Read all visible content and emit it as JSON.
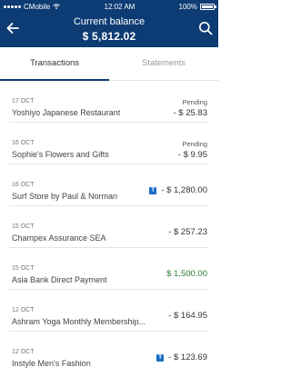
{
  "status_bar": {
    "carrier": "CMobile",
    "time": "12:02 AM",
    "battery": "100%"
  },
  "header": {
    "title": "Current balance",
    "balance": "$ 5,812.02"
  },
  "tabs": [
    {
      "label": "Transactions",
      "active": true
    },
    {
      "label": "Statements",
      "active": false
    }
  ],
  "transactions": [
    {
      "date": "17 OCT",
      "merchant": "Yoshiyo Japanese Restaurant",
      "status": "Pending",
      "amount": "- $ 25.83",
      "type": "debit",
      "icon": ""
    },
    {
      "date": "16 OCT",
      "merchant": "Sophie's Flowers and Gifts",
      "status": "Pending",
      "amount": "- $ 9.95",
      "type": "debit",
      "icon": ""
    },
    {
      "date": "16 OCT",
      "merchant": "Surf Store by Paul & Norman",
      "status": "",
      "amount": "- $ 1,280.00",
      "type": "debit",
      "icon": "card-icon"
    },
    {
      "date": "15 OCT",
      "merchant": "Champex Assurance SEA",
      "status": "",
      "amount": "- $ 257.23",
      "type": "debit",
      "icon": ""
    },
    {
      "date": "15 OCT",
      "merchant": "Asia Bank Direct Payment",
      "status": "",
      "amount": "$ 1,500.00",
      "type": "credit",
      "icon": ""
    },
    {
      "date": "12 OCT",
      "merchant": "Ashram Yoga Monthly Membership...",
      "status": "",
      "amount": "- $ 164.95",
      "type": "debit",
      "icon": ""
    },
    {
      "date": "12 OCT",
      "merchant": "Instyle Men's Fashion",
      "status": "",
      "amount": "- $ 123.69",
      "type": "debit",
      "icon": "card-icon"
    }
  ],
  "colors": {
    "brand": "#0d3b73",
    "credit": "#2e7d32",
    "icon": "#1a6cc4"
  }
}
